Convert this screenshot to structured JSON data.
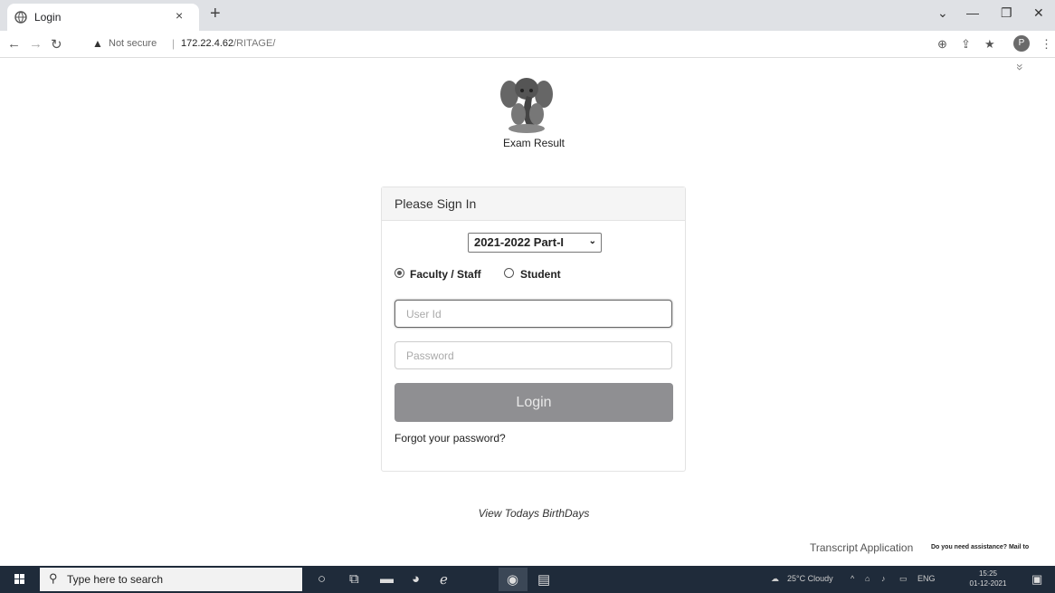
{
  "browser": {
    "tab_title": "Login",
    "tab_close": "×",
    "new_tab": "+",
    "window_controls": [
      "⌄",
      "—",
      "❐",
      "✕"
    ],
    "not_secure": "Not secure",
    "url_host": "172.22.4.62",
    "url_path": "/RITAGE/"
  },
  "logo": {
    "caption": "Exam Result"
  },
  "signin": {
    "title": "Please Sign In",
    "session_value": "2021-2022 Part-I",
    "role_options": [
      "Faculty / Staff",
      "Student"
    ],
    "selected_role": "Faculty / Staff",
    "userid_placeholder": "User Id",
    "password_placeholder": "Password",
    "login_label": "Login",
    "forgot_label": "Forgot your password?"
  },
  "footer": {
    "birthdays": "View Todays BirthDays",
    "transcript": "Transcript Application",
    "assistance": "Do you need assistance? Mail to"
  },
  "taskbar": {
    "search_placeholder": "Type here to search",
    "weather": "25°C  Cloudy",
    "language": "ENG",
    "time": "15:25",
    "date": "01-12-2021"
  },
  "colors": {
    "tab_strip": "#dfe1e5",
    "login_button": "#8f8f92",
    "taskbar": "#1f2b3a"
  }
}
